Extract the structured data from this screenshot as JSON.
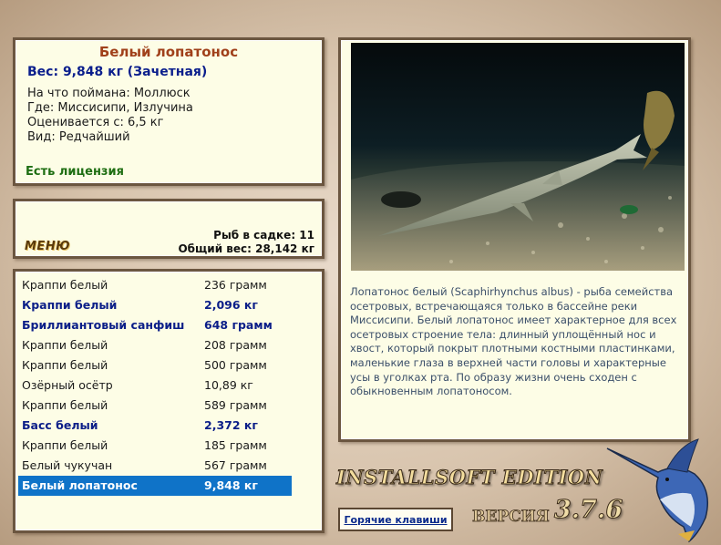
{
  "info": {
    "fish_name": "Белый лопатонос",
    "weight": "Вес: 9,848 кг (Зачетная)",
    "caught_on": "На что поймана: Моллюск",
    "location": "Где: Миссисипи, Излучина",
    "valued_from": "Оценивается с: 6,5 кг",
    "kind": "Вид: Редчайший",
    "license": "Есть лицензия"
  },
  "stats": {
    "menu_label": "МЕНЮ",
    "fish_in_cage": "Рыб в садке: 11",
    "total_weight": "Общий вес: 28,142 кг"
  },
  "catch_list": [
    {
      "name": "Краппи белый",
      "weight": "236 грамм",
      "style": "normal"
    },
    {
      "name": "Краппи белый",
      "weight": "2,096 кг",
      "style": "bold"
    },
    {
      "name": "Бриллиантовый санфиш",
      "weight": "648 грамм",
      "style": "bold"
    },
    {
      "name": "Краппи белый",
      "weight": "208 грамм",
      "style": "normal"
    },
    {
      "name": "Краппи белый",
      "weight": "500 грамм",
      "style": "normal"
    },
    {
      "name": "Озёрный осётр",
      "weight": "10,89 кг",
      "style": "normal"
    },
    {
      "name": "Краппи белый",
      "weight": "589 грамм",
      "style": "normal"
    },
    {
      "name": "Басс белый",
      "weight": "2,372 кг",
      "style": "bold"
    },
    {
      "name": "Краппи белый",
      "weight": "185 грамм",
      "style": "normal"
    },
    {
      "name": "Белый чукучан",
      "weight": "567 грамм",
      "style": "normal"
    },
    {
      "name": "Белый лопатонос",
      "weight": "9,848 кг",
      "style": "selected"
    }
  ],
  "description": "Лопатонос белый (Scaphirhynchus albus) - рыба семейства осетровых, встречающаяся только в бассейне реки Миссисипи. Белый лопатонос имеет характерное для всех осетровых строение тела: длинный уплощённый нос и хвост, который покрыт плотными костными пластинками, маленькие глаза в верхней части головы и характерные усы в уголках рта. По образу жизни очень сходен с обыкновенным лопатоносом.",
  "footer": {
    "edition": "INSTALLSOFT EDITION",
    "hotkeys": "Горячие клавиши",
    "version_label": "ВЕРСИЯ",
    "version_number": "3.7.6"
  },
  "colors": {
    "panel_bg": "#fdfde6",
    "panel_border": "#6b5640",
    "title_brown": "#a0401a",
    "weight_blue": "#0a1e8c",
    "license_green": "#1e6e12",
    "selection_blue": "#0f73c8"
  }
}
